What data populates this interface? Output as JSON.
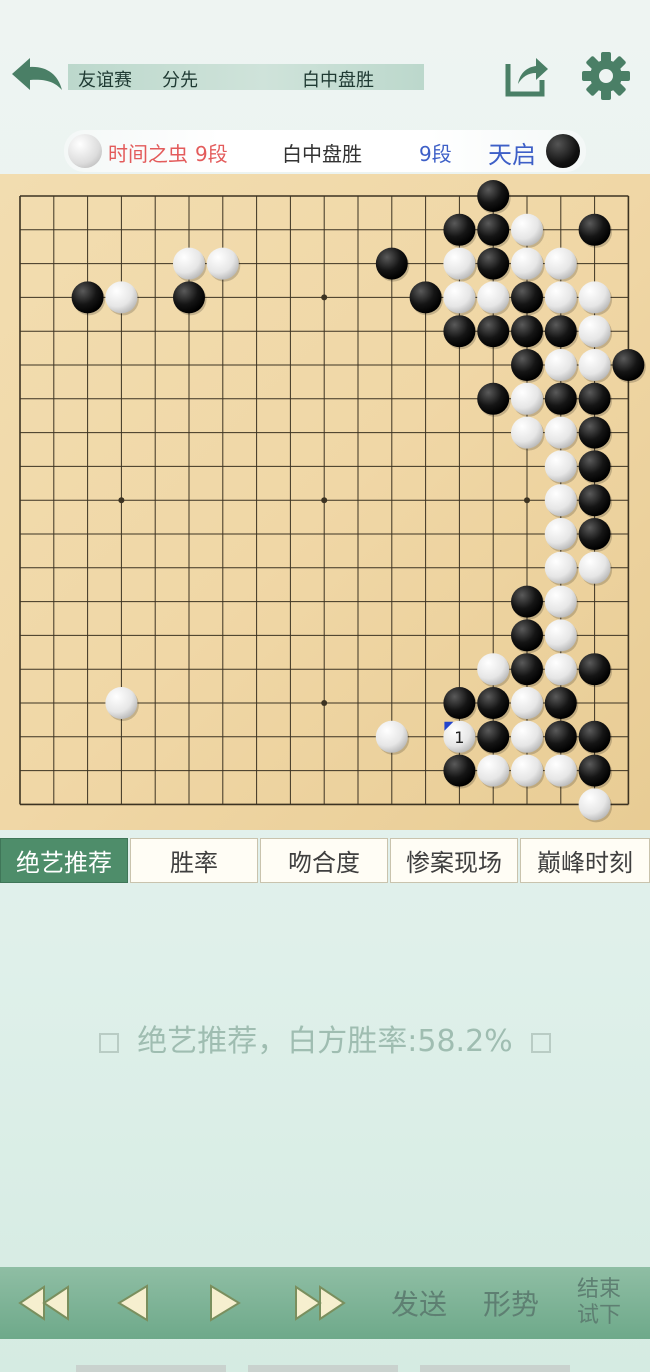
{
  "header": {
    "event": "友谊赛",
    "handicap": "分先",
    "result": "白中盘胜"
  },
  "players": {
    "white_name": "时间之虫",
    "white_rank": "9段",
    "result": "白中盘胜",
    "black_rank": "9段",
    "black_name": "天启"
  },
  "board": {
    "size": 19,
    "last_move_label": "1",
    "black": [
      [
        14,
        0
      ],
      [
        13,
        1
      ],
      [
        14,
        1
      ],
      [
        17,
        1
      ],
      [
        11,
        2
      ],
      [
        14,
        2
      ],
      [
        2,
        3
      ],
      [
        5,
        3
      ],
      [
        12,
        3
      ],
      [
        15,
        3
      ],
      [
        13,
        4
      ],
      [
        14,
        4
      ],
      [
        15,
        4
      ],
      [
        16,
        4
      ],
      [
        15,
        5
      ],
      [
        18,
        5
      ],
      [
        14,
        6
      ],
      [
        16,
        6
      ],
      [
        17,
        6
      ],
      [
        17,
        7
      ],
      [
        17,
        8
      ],
      [
        17,
        9
      ],
      [
        17,
        10
      ],
      [
        15,
        12
      ],
      [
        15,
        13
      ],
      [
        15,
        14
      ],
      [
        17,
        14
      ],
      [
        13,
        15
      ],
      [
        14,
        15
      ],
      [
        16,
        15
      ],
      [
        14,
        16
      ],
      [
        16,
        16
      ],
      [
        17,
        16
      ],
      [
        13,
        17
      ],
      [
        17,
        17
      ]
    ],
    "white": [
      [
        15,
        1
      ],
      [
        5,
        2
      ],
      [
        6,
        2
      ],
      [
        13,
        2
      ],
      [
        15,
        2
      ],
      [
        16,
        2
      ],
      [
        3,
        3
      ],
      [
        13,
        3
      ],
      [
        14,
        3
      ],
      [
        16,
        3
      ],
      [
        17,
        3
      ],
      [
        17,
        4
      ],
      [
        16,
        5
      ],
      [
        17,
        5
      ],
      [
        15,
        6
      ],
      [
        15,
        7
      ],
      [
        16,
        7
      ],
      [
        16,
        8
      ],
      [
        16,
        9
      ],
      [
        16,
        10
      ],
      [
        16,
        11
      ],
      [
        17,
        11
      ],
      [
        16,
        12
      ],
      [
        16,
        13
      ],
      [
        14,
        14
      ],
      [
        16,
        14
      ],
      [
        3,
        15
      ],
      [
        15,
        15
      ],
      [
        11,
        16
      ],
      [
        13,
        16
      ],
      [
        15,
        16
      ],
      [
        14,
        17
      ],
      [
        15,
        17
      ],
      [
        16,
        17
      ],
      [
        17,
        18
      ]
    ],
    "last_move": [
      13,
      16
    ]
  },
  "tabs": [
    "绝艺推荐",
    "胜率",
    "吻合度",
    "惨案现场",
    "巅峰时刻"
  ],
  "recommend_text": "绝艺推荐，白方胜率:58.2%",
  "bottom": {
    "send": "发送",
    "situation": "形势",
    "end_try_1": "结束",
    "end_try_2": "试下"
  },
  "colors": {
    "accent": "#4e8d6a",
    "board": "#f0d9a8",
    "white_player": "#e35b5b",
    "black_player": "#3d5fc7"
  }
}
